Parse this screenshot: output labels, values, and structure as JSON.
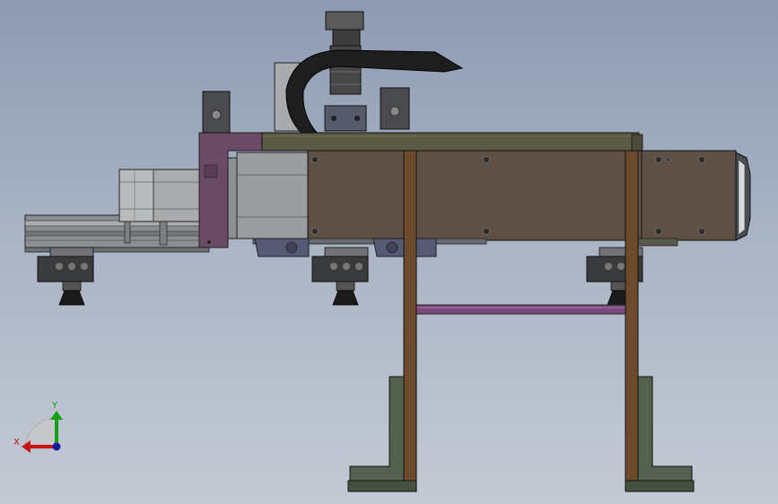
{
  "scene": {
    "title": "",
    "colors": {
      "background_top": "#8d9bb2",
      "background_bottom": "#c3cad4",
      "plate_brown": "#5e5044",
      "top_plate_olive": "#5b5a45",
      "rail_gray": "#8a8d90",
      "bracket_purple": "#6b4a66",
      "motor_silver": "#b3b5b7",
      "leg_brown": "#6e4a2c",
      "foot_green": "#54614f",
      "crossbar_purple": "#7a4a7c",
      "cable_chain": "#1e1e1e"
    },
    "parts": [
      "linear-module-base-rail",
      "servo-motor",
      "slide-plate",
      "top-plate",
      "cable-drag-chain",
      "vertical-cylinder",
      "suction-cup-assembly",
      "support-leg-left",
      "support-leg-right",
      "cross-bar",
      "floor-foot-bracket"
    ]
  },
  "triad": {
    "x_label": "X",
    "y_label": "Y",
    "x_color": "#c81414",
    "y_color": "#14a014",
    "origin_color": "#1a1aa0"
  }
}
